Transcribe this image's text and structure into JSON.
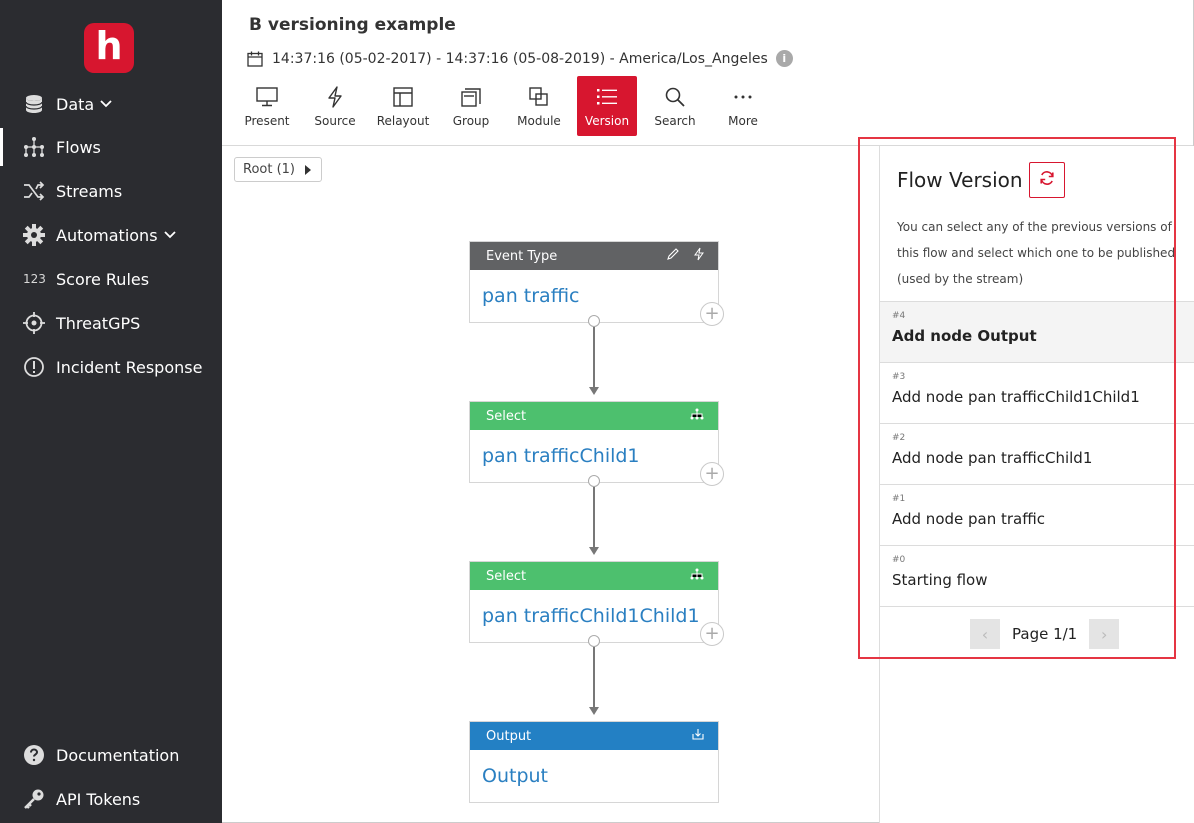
{
  "sidebar": {
    "logo_letter": "h",
    "items": [
      {
        "label": "Data",
        "icon": "database-icon"
      },
      {
        "label": "Flows",
        "icon": "flows-icon"
      },
      {
        "label": "Streams",
        "icon": "shuffle-icon"
      },
      {
        "label": "Automations",
        "icon": "gear-icon"
      },
      {
        "label": "Score Rules",
        "icon": "123-icon",
        "icon_text": "123"
      },
      {
        "label": "ThreatGPS",
        "icon": "crosshair-icon"
      },
      {
        "label": "Incident Response",
        "icon": "alert-circle-icon"
      },
      {
        "label": "Documentation",
        "icon": "help-circle-icon"
      },
      {
        "label": "API Tokens",
        "icon": "key-icon"
      }
    ]
  },
  "header": {
    "title": "B versioning example",
    "date_range": "14:37:16 (05-02-2017) - 14:37:16 (05-08-2019) - America/Los_Angeles",
    "info_glyph": "i"
  },
  "toolbar": {
    "present": "Present",
    "source": "Source",
    "relayout": "Relayout",
    "group": "Group",
    "module": "Module",
    "version": "Version",
    "search": "Search",
    "more": "More"
  },
  "canvas": {
    "breadcrumb": "Root (1)",
    "nodes": [
      {
        "type": "Event Type",
        "name": "pan traffic"
      },
      {
        "type": "Select",
        "name": "pan trafficChild1"
      },
      {
        "type": "Select",
        "name": "pan trafficChild1Child1"
      },
      {
        "type": "Output",
        "name": "Output"
      }
    ]
  },
  "panel": {
    "title": "Flow Version",
    "description": "You can select any of the previous versions of this flow and select which one to be published (used by the stream)",
    "versions": [
      {
        "num": "#4",
        "label": "Add node Output"
      },
      {
        "num": "#3",
        "label": "Add node pan trafficChild1Child1"
      },
      {
        "num": "#2",
        "label": "Add node pan trafficChild1"
      },
      {
        "num": "#1",
        "label": "Add node pan traffic"
      },
      {
        "num": "#0",
        "label": "Starting flow"
      }
    ],
    "page_text": "Page 1/1",
    "prev_glyph": "‹",
    "next_glyph": "›"
  },
  "colors": {
    "brand": "#d7162f",
    "sidebar_bg": "#2b2c30",
    "node_event_type": "#616264",
    "node_select": "#4dc06e",
    "node_output": "#2380c4",
    "node_text": "#2a7fc1",
    "highlight": "#e53543"
  }
}
